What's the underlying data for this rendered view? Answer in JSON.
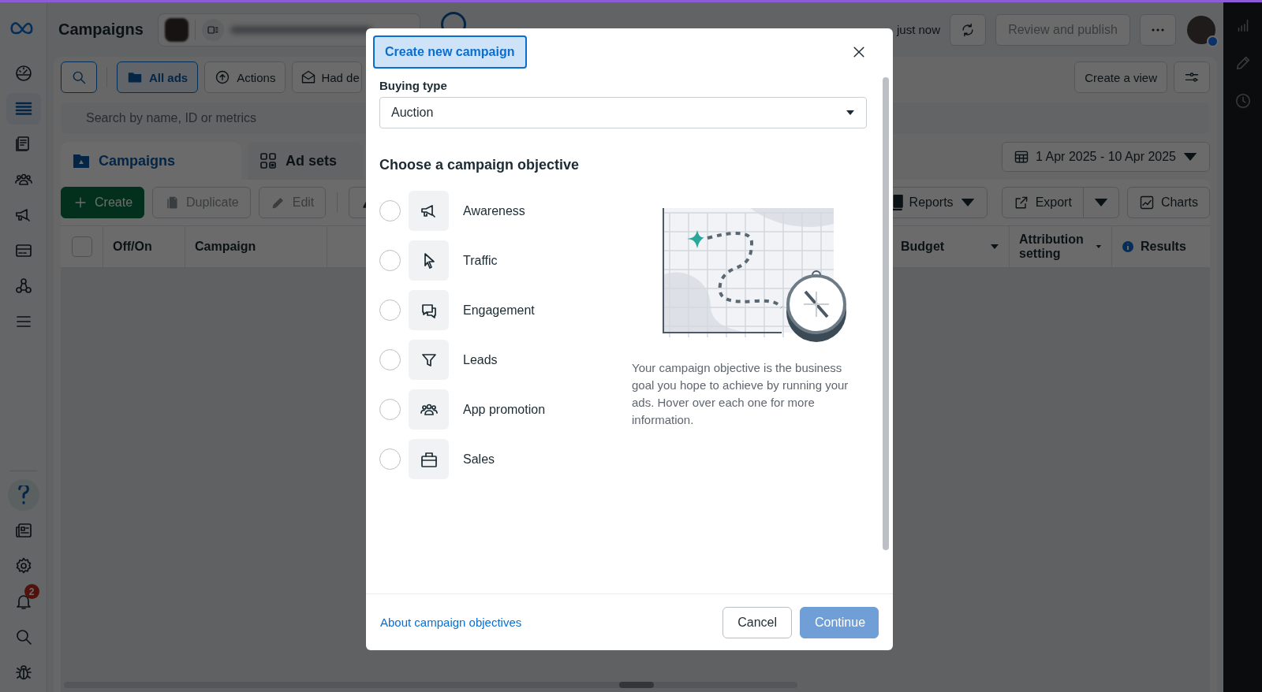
{
  "nav_rail": {
    "top_items": [
      {
        "selected": false
      },
      {
        "selected": true
      },
      {
        "selected": false
      },
      {
        "selected": false
      },
      {
        "selected": false
      },
      {
        "selected": false
      },
      {
        "selected": false
      },
      {
        "selected": false
      }
    ],
    "bottom_items": [
      {
        "selected": true
      },
      {
        "selected": false
      },
      {
        "selected": false
      },
      {
        "selected": false
      },
      {
        "selected": false
      },
      {
        "selected": false
      }
    ],
    "notification_count": "2"
  },
  "header": {
    "title": "Campaigns",
    "status": "just now",
    "publish_button": {
      "label": "Review and publish",
      "disabled": true
    }
  },
  "top_toolbar": {
    "left": [
      {
        "kind": "icon"
      },
      {
        "kind": "folder",
        "label": "All ads",
        "selected": true
      },
      {
        "kind": "upload",
        "label": "Actions",
        "selected": false
      },
      {
        "kind": "mail",
        "label": "Had de",
        "selected": false
      }
    ],
    "create_view": "Create a view"
  },
  "search": {
    "placeholder": "Search by name, ID or metrics"
  },
  "tabs": [
    {
      "label": "Campaigns",
      "selected": true
    },
    {
      "label": "Ad sets",
      "selected": false
    }
  ],
  "date_range": "1 Apr 2025 - 10 Apr 2025",
  "action_toolbar": {
    "left": [
      {
        "kind": "create",
        "label": "Create",
        "disabled": false
      },
      {
        "kind": "duplicate",
        "label": "Duplicate",
        "disabled": true
      },
      {
        "kind": "edit",
        "label": "Edit",
        "disabled": true
      },
      {
        "kind": "flask",
        "disabled": false
      }
    ],
    "right": [
      {
        "kind": "reports",
        "label": "Reports"
      },
      {
        "kind": "export",
        "label": "Export"
      },
      {
        "kind": "charts",
        "label": "Charts"
      }
    ]
  },
  "table": {
    "columns_left": [
      {
        "kind": "check",
        "checked": false
      },
      {
        "kind": "text",
        "label": "Off/On"
      },
      {
        "kind": "text",
        "label": "Campaign"
      }
    ],
    "columns_right": [
      {
        "kind": "dropdown",
        "label": "Budget"
      },
      {
        "kind": "dropdown",
        "label": "Attribution setting"
      },
      {
        "kind": "info",
        "label": "Results"
      }
    ]
  },
  "dialog": {
    "title": "Create new campaign",
    "buying_type_label": "Buying type",
    "buying_type": "Auction",
    "heading": "Choose a campaign objective",
    "objectives": [
      {
        "kind": "megaphone",
        "label": "Awareness",
        "selected": false
      },
      {
        "kind": "cursor",
        "label": "Traffic",
        "selected": false
      },
      {
        "kind": "chat",
        "label": "Engagement",
        "selected": false
      },
      {
        "kind": "funnel",
        "label": "Leads",
        "selected": false
      },
      {
        "kind": "people",
        "label": "App promotion",
        "selected": false
      },
      {
        "kind": "bag",
        "label": "Sales",
        "selected": false
      }
    ],
    "description": "Your campaign objective is the business goal you hope to achieve by running your ads. Hover over each one for more information.",
    "link": "About campaign objectives",
    "cancel": "Cancel",
    "continue": {
      "label": "Continue",
      "disabled": true
    }
  }
}
